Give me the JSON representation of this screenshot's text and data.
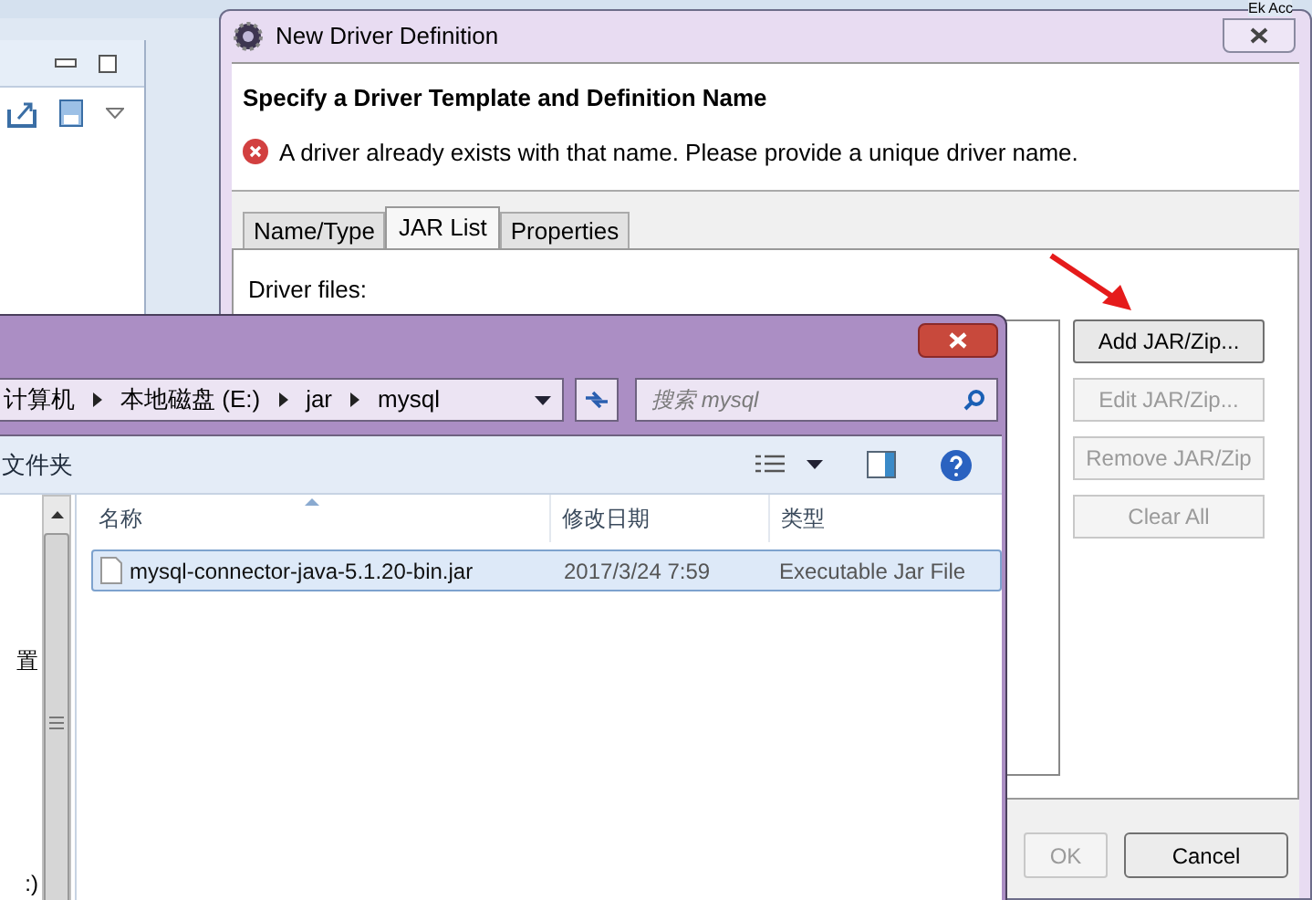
{
  "background": {
    "corner_text": "Ek Acc"
  },
  "dialog": {
    "title": "New Driver Definition",
    "header": {
      "title": "Specify a Driver Template and Definition Name",
      "error": "A driver already exists with that name. Please provide a unique driver name."
    },
    "tabs": [
      {
        "label": "Name/Type",
        "selected": false
      },
      {
        "label": "JAR List",
        "selected": true
      },
      {
        "label": "Properties",
        "selected": false
      }
    ],
    "driver_files_label": "Driver files:",
    "buttons": [
      {
        "label": "Add JAR/Zip...",
        "disabled": false
      },
      {
        "label": "Edit JAR/Zip...",
        "disabled": true
      },
      {
        "label": "Remove JAR/Zip",
        "disabled": true
      },
      {
        "label": "Clear All",
        "disabled": true
      }
    ],
    "footer_buttons": [
      {
        "label": "OK",
        "disabled": true
      },
      {
        "label": "Cancel",
        "disabled": false
      }
    ]
  },
  "explorer": {
    "breadcrumbs": [
      "计算机",
      "本地磁盘 (E:)",
      "jar",
      "mysql"
    ],
    "search": {
      "placeholder": "搜索 mysql"
    },
    "toolbar_label": "文件夹",
    "nav_items": [
      "置",
      ":)"
    ],
    "columns": [
      "名称",
      "修改日期",
      "类型"
    ],
    "rows": [
      {
        "name": "mysql-connector-java-5.1.20-bin.jar",
        "date": "2017/3/24 7:59",
        "type": "Executable Jar File",
        "selected": true
      }
    ]
  }
}
